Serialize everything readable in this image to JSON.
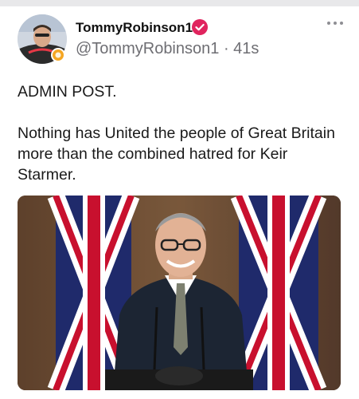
{
  "author": {
    "display_name": "TommyRobinson1",
    "handle": "@TommyRobinson1",
    "separator": "·",
    "time": "41s"
  },
  "icons": {
    "avatar": "profile-photo",
    "badge": "gold-badge",
    "verified": "verified-check-icon",
    "more": "more-options-icon"
  },
  "post": {
    "line1": "ADMIN POST.",
    "line2": "Nothing has United the people of Great Britain more than the combined hatred for Keir Starmer."
  },
  "media": {
    "type": "photo",
    "description_icon": "press-conference-photo"
  },
  "colors": {
    "verified": "#e0245e",
    "text": "#1a1a1a",
    "secondary": "#6e6e73"
  }
}
